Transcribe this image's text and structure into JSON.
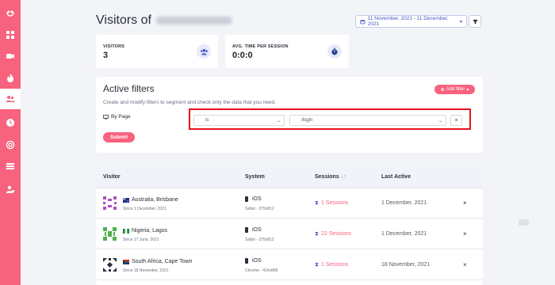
{
  "sidebar": {
    "items": [
      {
        "icon": "logo-icon"
      },
      {
        "icon": "grid-icon"
      },
      {
        "icon": "video-icon"
      },
      {
        "icon": "fire-icon"
      },
      {
        "icon": "users-icon",
        "active": true
      },
      {
        "icon": "clock-icon"
      },
      {
        "icon": "target-icon"
      },
      {
        "icon": "list-icon"
      },
      {
        "icon": "user-settings-icon"
      }
    ],
    "color": "#f7627e"
  },
  "header": {
    "title": "Visitors of",
    "date_range": "11 November, 2021 - 11 December, 2021"
  },
  "stats": [
    {
      "label": "VISITORS",
      "value": "3",
      "icon": "users-icon"
    },
    {
      "label": "AVG. TIME PER SESSION",
      "value": "0:0:0",
      "icon": "stopwatch-icon"
    }
  ],
  "filters": {
    "title": "Active filters",
    "add_label": "Add filter",
    "description": "Create and modify filters to segment and check only the data that you need.",
    "by_page_label": "By Page",
    "operator": "is",
    "value": "/login",
    "submit_label": "Submit"
  },
  "table": {
    "headers": {
      "visitor": "Visitor",
      "system": "System",
      "sessions": "Sessions",
      "last_active": "Last Active"
    },
    "rows": [
      {
        "location": "Australia, Brisbane",
        "since": "Since 1 December, 2021",
        "os": "iOS",
        "browser": "Safari - 375x812",
        "sessions": "1 Sessions",
        "last_active": "1 December, 2021",
        "avatar_color": "#b04fc0",
        "flag": "au"
      },
      {
        "location": "Nigeria, Lagos",
        "since": "Since 17 June, 2021",
        "os": "iOS",
        "browser": "Safari - 375x812",
        "sessions": "22 Sessions",
        "last_active": "1 December, 2021",
        "avatar_color": "#4fb04f",
        "flag": "ng"
      },
      {
        "location": "South Africa, Cape Town",
        "since": "Since 18 November, 2021",
        "os": "iOS",
        "browser": "Chrome - 414x896",
        "sessions": "1 Sessions",
        "last_active": "18 November, 2021",
        "avatar_color": "#2b2f3a",
        "flag": "za"
      }
    ]
  },
  "colors": {
    "accent": "#f7627e",
    "link_blue": "#4657c4",
    "highlight_red": "#e8121c"
  }
}
